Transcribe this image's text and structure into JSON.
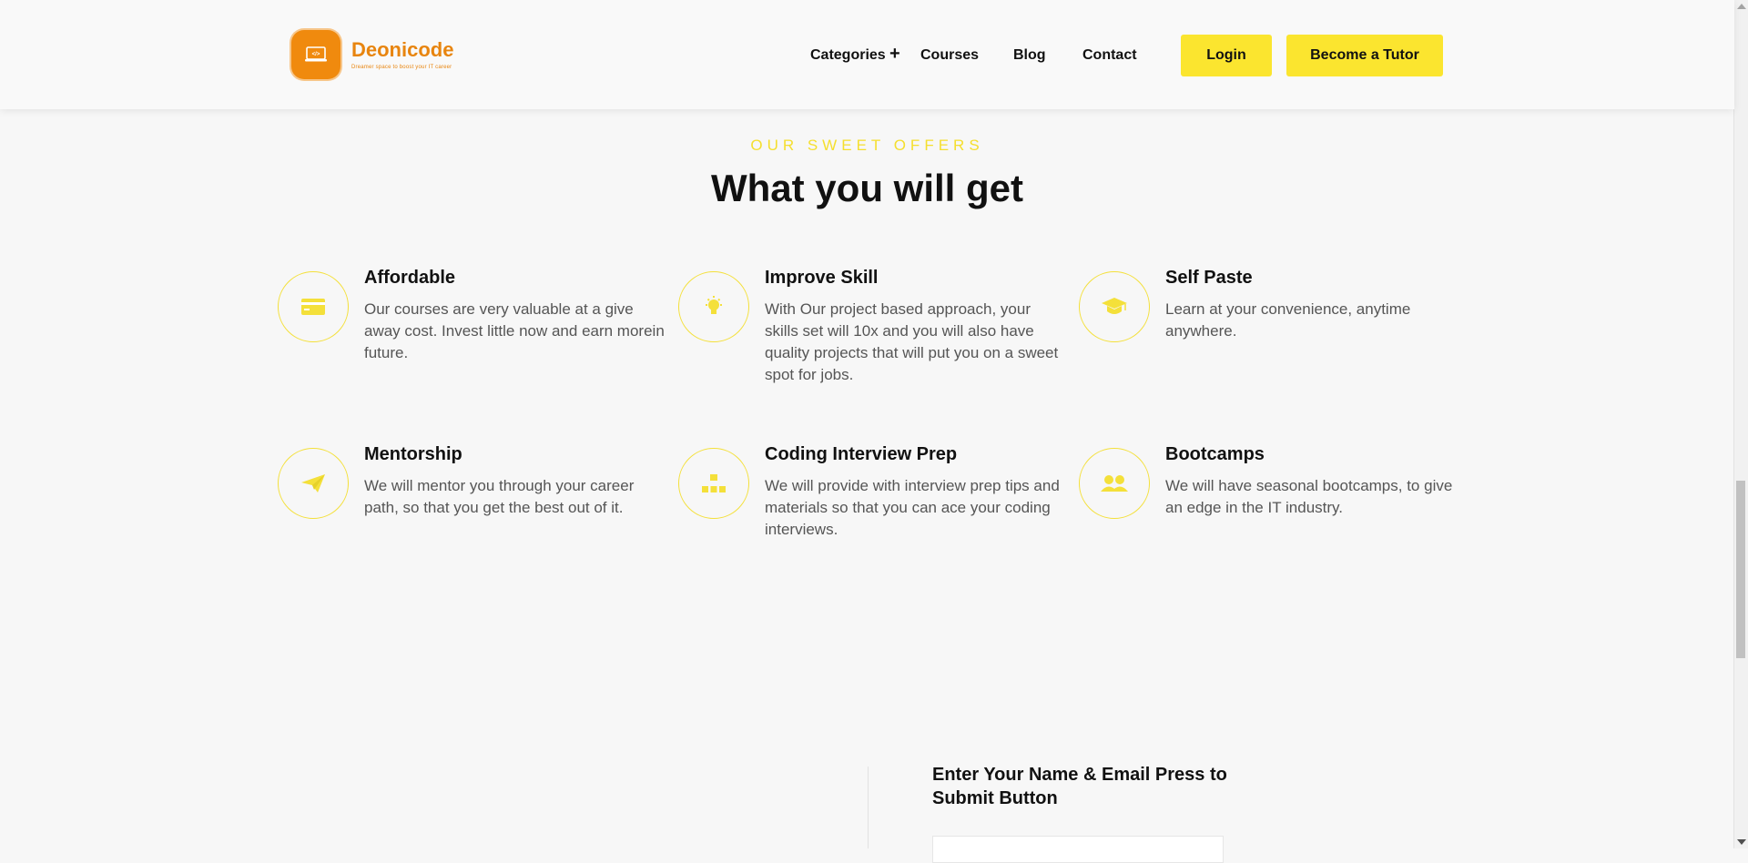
{
  "brand": {
    "name": "Deonicode",
    "tagline": "Dreamer space to boost your IT career",
    "badge_color": "#f08a0e"
  },
  "nav": {
    "items": [
      "Categories",
      "Courses",
      "Blog",
      "Contact"
    ],
    "categories_expand": "+",
    "login_label": "Login",
    "tutor_label": "Become a Tutor"
  },
  "offers": {
    "eyebrow": "OUR SWEET OFFERS",
    "title": "What you will get",
    "features": [
      {
        "icon": "credit-card-icon",
        "title": "Affordable",
        "desc": "Our courses are very valuable at a give away cost. Invest little now and earn morein future."
      },
      {
        "icon": "lightbulb-icon",
        "title": "Improve Skill",
        "desc": "With Our project based approach, your skills set will 10x and you will also have quality projects that will put you on a sweet spot for jobs."
      },
      {
        "icon": "graduation-cap-icon",
        "title": "Self Paste",
        "desc": "Learn at your convenience, anytime anywhere."
      },
      {
        "icon": "paper-plane-icon",
        "title": "Mentorship",
        "desc": "We will mentor you through your career path, so that you get the best out of it."
      },
      {
        "icon": "hierarchy-icon",
        "title": "Coding Interview Prep",
        "desc": "We will provide with interview prep tips and materials so that you can ace your coding interviews."
      },
      {
        "icon": "users-icon",
        "title": "Bootcamps",
        "desc": "We will have seasonal bootcamps, to give an edge in the IT industry."
      }
    ]
  },
  "subscribe": {
    "title": "Enter Your Name & Email Press to Submit Button"
  },
  "colors": {
    "accent_yellow": "#fbe52f",
    "brand_orange": "#e8850f",
    "icon_yellow": "#f4e03a"
  }
}
